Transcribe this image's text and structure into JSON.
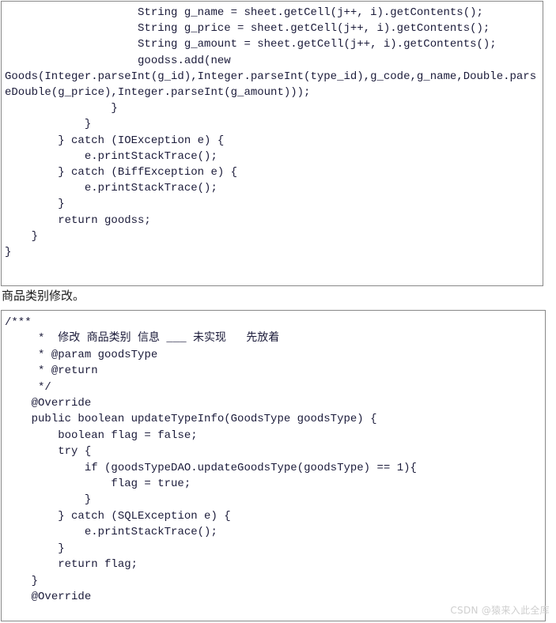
{
  "document": {
    "language": "java",
    "watermark": "CSDN @猿来入此全库"
  },
  "code_block_1": {
    "name": "excel-import-goods-snippet",
    "lines": [
      "                    String g_name = sheet.getCell(j++, i).getContents();",
      "                    String g_price = sheet.getCell(j++, i).getContents();",
      "                    String g_amount = sheet.getCell(j++, i).getContents();",
      "                    goodss.add(new",
      "Goods(Integer.parseInt(g_id),Integer.parseInt(type_id),g_code,g_name,Double.parseDouble(g_price),Integer.parseInt(g_amount)));",
      "                }",
      "            }",
      "        } catch (IOException e) {",
      "            e.printStackTrace();",
      "        } catch (BiffException e) {",
      "            e.printStackTrace();",
      "        }",
      "        return goodss;",
      "    }",
      "}"
    ]
  },
  "caption": {
    "text": "商品类别修改。"
  },
  "code_block_2": {
    "name": "update-goods-type-snippet",
    "lines": [
      "/***",
      "     *  修改 商品类别 信息 ___ 未实现   先放着",
      "     * @param goodsType",
      "     * @return",
      "     */",
      "    @Override",
      "    public boolean updateTypeInfo(GoodsType goodsType) {",
      "        boolean flag = false;",
      "        try {",
      "            if (goodsTypeDAO.updateGoodsType(goodsType) == 1){",
      "                flag = true;",
      "            }",
      "        } catch (SQLException e) {",
      "            e.printStackTrace();",
      "        }",
      "        return flag;",
      "    }",
      "    @Override"
    ]
  }
}
